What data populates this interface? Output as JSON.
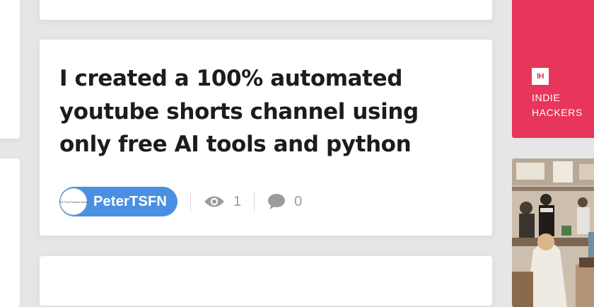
{
  "post": {
    "title": "I created a 100% automated youtube shorts channel using only free AI tools and python",
    "author": {
      "name": "PeterTSFN",
      "avatar_caption": "The Tech Finance Nexus"
    },
    "views": "1",
    "comments": "0"
  },
  "sidebar_ads": {
    "indie_hackers": {
      "logo": "IH",
      "line1": "INDIE",
      "line2": "HACKERS"
    }
  },
  "colors": {
    "author_pill": "#4a90e2",
    "indie_hackers_brand": "#e8355b",
    "page_background": "#e6e6e6",
    "stat_icon": "#9b9b9b"
  },
  "icons": {
    "views": "eye-icon",
    "comments": "speech-bubble-icon"
  }
}
